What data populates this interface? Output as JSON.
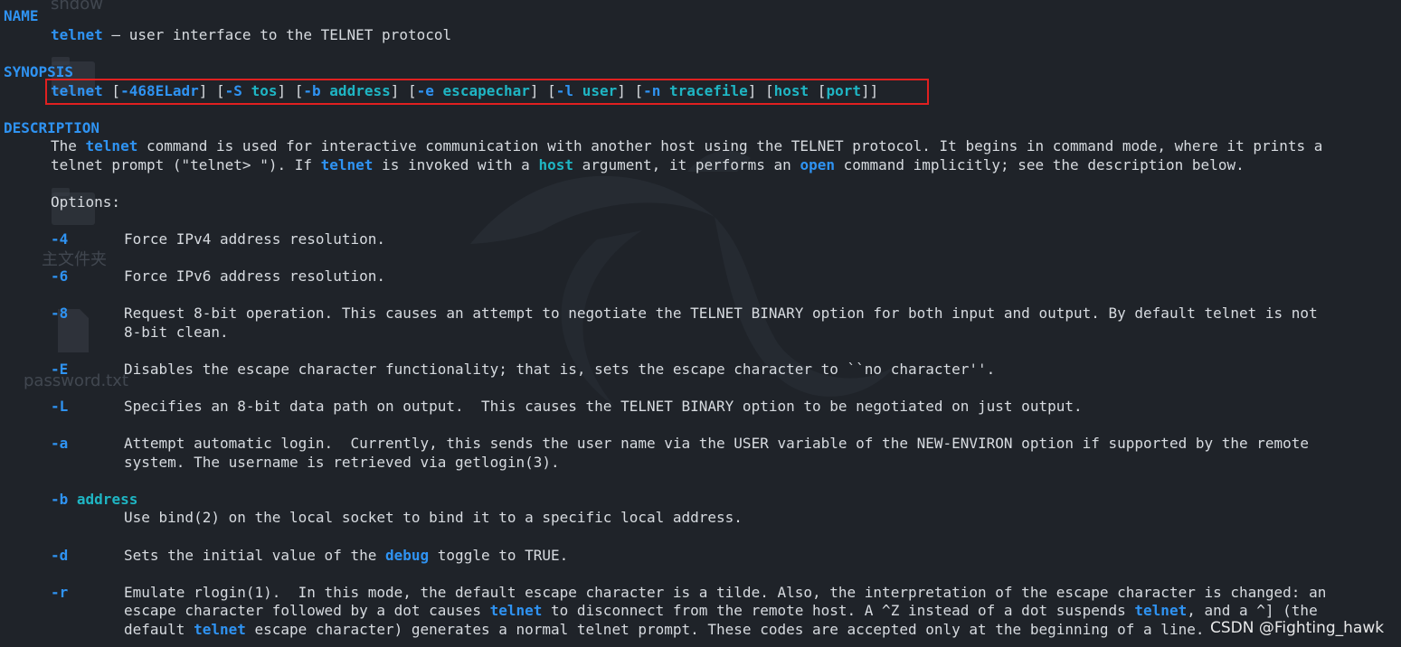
{
  "sections": {
    "name": "NAME",
    "synopsis": "SYNOPSIS",
    "description": "DESCRIPTION"
  },
  "name_line": {
    "cmd": "telnet",
    "text": " — user interface to the TELNET protocol"
  },
  "synopsis_line": {
    "p1": "telnet",
    "p2": " [",
    "p3": "-468ELadr",
    "p4": "] [",
    "p5": "-S",
    "p6": " ",
    "p7": "tos",
    "p8": "] [",
    "p9": "-b",
    "p10": " ",
    "p11": "address",
    "p12": "] [",
    "p13": "-e",
    "p14": " ",
    "p15": "escapechar",
    "p16": "] [",
    "p17": "-l",
    "p18": " ",
    "p19": "user",
    "p20": "] [",
    "p21": "-n",
    "p22": " ",
    "p23": "tracefile",
    "p24": "] [",
    "p25": "host",
    "p26": " [",
    "p27": "port",
    "p28": "]]"
  },
  "desc": {
    "l1": {
      "a": "The ",
      "b": "telnet",
      "c": " command is used for interactive communication with another host using the TELNET protocol. It begins in command mode, where it prints a"
    },
    "l2": {
      "a": "telnet prompt (\"telnet> \"). If ",
      "b": "telnet",
      "c": " is invoked with a ",
      "d": "host",
      "e": " argument, it performs an ",
      "f": "open",
      "g": " command implicitly; see the description below."
    },
    "options_label": "Options:"
  },
  "options": {
    "o4": {
      "flag": "-4",
      "text": "Force IPv4 address resolution."
    },
    "o6": {
      "flag": "-6",
      "text": "Force IPv6 address resolution."
    },
    "o8": {
      "flag": "-8",
      "text1": "Request 8-bit operation. This causes an attempt to negotiate the TELNET BINARY option for both input and output. By default telnet is not",
      "text2": "8-bit clean."
    },
    "oE": {
      "flag": "-E",
      "text": "Disables the escape character functionality; that is, sets the escape character to ``no character''."
    },
    "oL": {
      "flag": "-L",
      "text": "Specifies an 8-bit data path on output.  This causes the TELNET BINARY option to be negotiated on just output."
    },
    "oa": {
      "flag": "-a",
      "text1": "Attempt automatic login.  Currently, this sends the user name via the USER variable of the NEW-ENVIRON option if supported by the remote",
      "text2": "system. The username is retrieved via getlogin(3)."
    },
    "ob": {
      "flag": "-b",
      "arg": "address",
      "text": "Use bind(2) on the local socket to bind it to a specific local address."
    },
    "od": {
      "flag": "-d",
      "a": "Sets the initial value of the ",
      "b": "debug",
      "c": " toggle to TRUE."
    },
    "or": {
      "flag": "-r",
      "l1": "Emulate rlogin(1).  In this mode, the default escape character is a tilde. Also, the interpretation of the escape character is changed: an",
      "l2a": "escape character followed by a dot causes ",
      "l2b": "telnet",
      "l2c": " to disconnect from the remote host. A ^Z instead of a dot suspends ",
      "l2d": "telnet",
      "l2e": ", and a ^] (the",
      "l3a": "default ",
      "l3b": "telnet",
      "l3c": " escape character) generates a normal telnet prompt. These codes are accepted only at the beginning of a line."
    }
  },
  "desktop": {
    "label1": "shdow",
    "label2": "主文件夹",
    "label3": "password.txt"
  },
  "watermark": "CSDN @Fighting_hawk",
  "colors": {
    "background": "#1f2329",
    "text": "#d7dbe0",
    "keyword_blue": "#2f93f2",
    "keyword_cyan": "#1fb5c3",
    "highlight_box": "#e02020"
  }
}
